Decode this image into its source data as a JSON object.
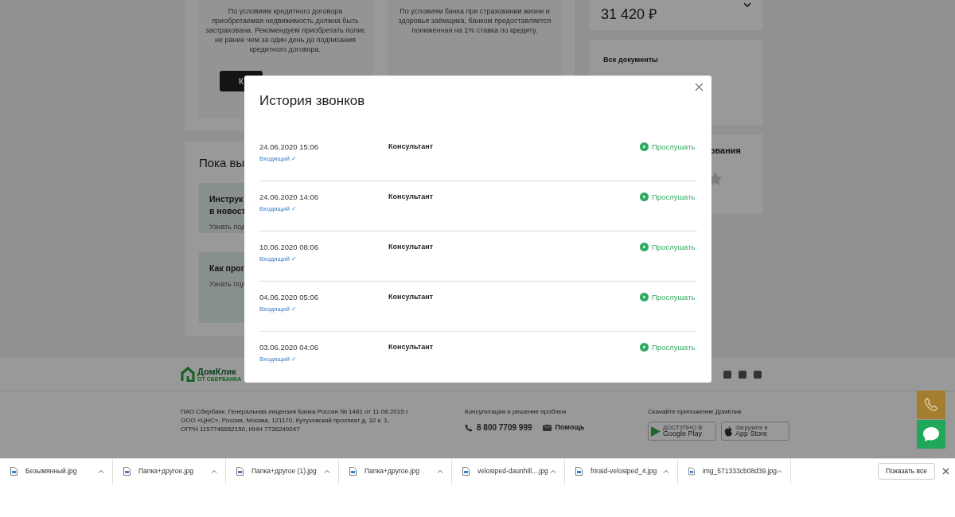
{
  "insurance_cards": [
    {
      "text": "По условиям кредитного договора приобретаемая недвижимость должна быть застрахована. Рекомендуем приобретать полис не ранее чем за один день до подписания кредитного договора.",
      "button": "К"
    },
    {
      "text": "По условиям банка при страховании жизни и здоровья заёмщика, банком предоставляется пониженная на 1% ставка по кредиту."
    }
  ],
  "promo": {
    "title": "Пока вы",
    "cards": [
      {
        "title_lines": [
          "Инструк",
          "в новост"
        ],
        "link": "Узнать под"
      },
      {
        "title_lines": [
          "Как прог"
        ],
        "link": "Узнать под"
      }
    ]
  },
  "sidebar": {
    "price": "31 420 ₽",
    "documents": [
      "Все документы"
    ],
    "rating_title": "ования"
  },
  "footer": {
    "logo_title": "ДомКлик",
    "logo_subtitle": "ОТ СБЕРБАНКА",
    "legal": [
      "ПАО Сбербанк. Генеральная лицензия Банка России № 1481 от 11.08.2015 г.",
      "ООО «ЦНС», Россия, Москва, 121170, Кутузовский проспект д. 32 к. 1,",
      "ОГРН 1157746652150, ИНН 7736249247"
    ],
    "support_title": "Консультация и решение проблем",
    "phone": "8 800 7709 999",
    "help": "Помощь",
    "app_title": "Скачайте приложение ДомКлик",
    "stores": [
      {
        "kind": "google",
        "small": "ДОСТУПНО В",
        "name": "Google Play"
      },
      {
        "kind": "apple",
        "small": "Загрузите в",
        "name": "App Store"
      }
    ]
  },
  "modal": {
    "title": "История звонков",
    "calls": [
      {
        "datetime": "24.06.2020 15:06",
        "direction": "Входящий ✓",
        "caller": "Консультант",
        "action": "Прослушать"
      },
      {
        "datetime": "24.06.2020 14:06",
        "direction": "Входящий ✓",
        "caller": "Консультант",
        "action": "Прослушать"
      },
      {
        "datetime": "10.06.2020 08:06",
        "direction": "Входящий ✓",
        "caller": "Консультант",
        "action": "Прослушать"
      },
      {
        "datetime": "04.06.2020 05:06",
        "direction": "Входящий ✓",
        "caller": "Консультант",
        "action": "Прослушать"
      },
      {
        "datetime": "03.06.2020 04:06",
        "direction": "Входящий ✓",
        "caller": "Консультант",
        "action": "Прослушать"
      }
    ]
  },
  "downloads": {
    "files": [
      "Безымянный.jpg",
      "Папка+другое.jpg",
      "Папка+другое (1).jpg",
      "Папка+другое.jpg",
      "velosiped-daunhill....jpg",
      "friraid-velosiped_4.jpg",
      "img_571333cb08d39.jpg"
    ],
    "show_all": "Показать все"
  }
}
